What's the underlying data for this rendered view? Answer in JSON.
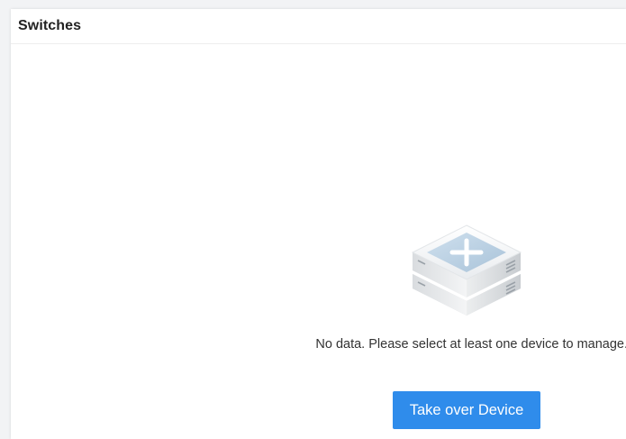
{
  "panel": {
    "title": "Switches"
  },
  "empty_state": {
    "icon": "device-stack-add-icon",
    "message": "No data. Please select at least one device to manage.",
    "action_label": "Take over Device"
  },
  "colors": {
    "accent": "#2f8ceb",
    "background": "#ffffff"
  }
}
